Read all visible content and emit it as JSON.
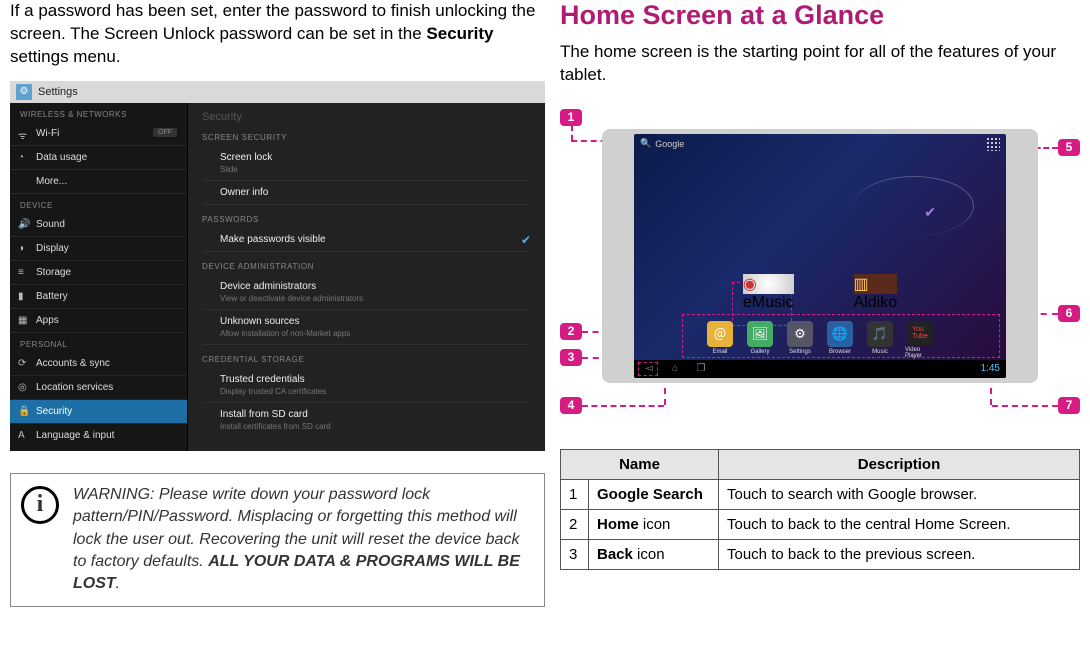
{
  "left": {
    "intro_a": "If a password has been set, enter the password to finish unlocking the screen. The Screen Unlock password can be set in the ",
    "intro_b": "Security",
    "intro_c": " settings menu."
  },
  "settings": {
    "app": "Settings",
    "side": {
      "h1": "WIRELESS & NETWORKS",
      "wifi": "Wi-Fi",
      "wifi_off": "OFF",
      "data": "Data usage",
      "more": "More...",
      "h2": "DEVICE",
      "sound": "Sound",
      "display": "Display",
      "storage": "Storage",
      "battery": "Battery",
      "apps": "Apps",
      "h3": "PERSONAL",
      "acc": "Accounts & sync",
      "loc": "Location services",
      "sec": "Security",
      "lang": "Language & input"
    },
    "main": {
      "title": "Security",
      "sh1": "SCREEN SECURITY",
      "lock": "Screen lock",
      "lock_sub": "Slide",
      "owner": "Owner info",
      "sh2": "PASSWORDS",
      "vis": "Make passwords visible",
      "sh3": "DEVICE ADMINISTRATION",
      "adm": "Device administrators",
      "adm_sub": "View or deactivate device administrators",
      "unk": "Unknown sources",
      "unk_sub": "Allow installation of non-Market apps",
      "sh4": "CREDENTIAL STORAGE",
      "trust": "Trusted credentials",
      "trust_sub": "Display trusted CA certificates",
      "sd": "Install from SD card",
      "sd_sub": "Install certificates from SD card"
    }
  },
  "warning": {
    "text_a": "WARNING: Please write down your password lock pattern/PIN/Password. Misplacing or forgetting this method will lock the user out. Recovering the unit will reset the device back to factory defaults. ",
    "text_b": "ALL YOUR DATA & PROGRAMS WILL BE LOST",
    "text_c": "."
  },
  "right": {
    "title": "Home Screen at a Glance",
    "intro": "The home screen is the starting point for all of the features of your tablet."
  },
  "tablet": {
    "search": "Google",
    "apps": {
      "emusic": "eMusic",
      "email": "Email",
      "gallery": "Gallery",
      "settings": "Settings",
      "browser": "Browser",
      "aldiko": "Aldiko",
      "music": "Music",
      "video": "Video Player"
    },
    "time": "1:45"
  },
  "callouts": {
    "c1": "1",
    "c2": "2",
    "c3": "3",
    "c4": "4",
    "c5": "5",
    "c6": "6",
    "c7": "7"
  },
  "table": {
    "h_name": "Name",
    "h_desc": "Description",
    "rows": [
      {
        "n": "1",
        "name_a": "Google Search",
        "name_b": "",
        "desc": "Touch to search with Google browser."
      },
      {
        "n": "2",
        "name_a": "Home",
        "name_b": " icon",
        "desc": "Touch to back to the central Home Screen."
      },
      {
        "n": "3",
        "name_a": "Back",
        "name_b": " icon",
        "desc": "Touch to back to the previous screen."
      }
    ]
  }
}
